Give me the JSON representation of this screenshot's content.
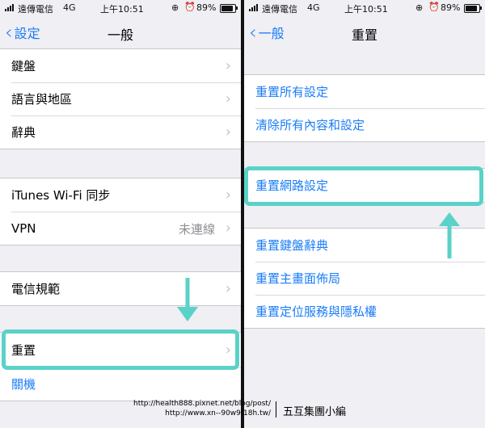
{
  "status_bar": {
    "carrier": "遠傳電信",
    "network": "4G",
    "time": "上午10:51",
    "battery_percent": "89%",
    "battery_level": 0.89
  },
  "left_screen": {
    "back_label": "設定",
    "title": "一般",
    "group1": [
      {
        "label": "鍵盤"
      },
      {
        "label": "語言與地區"
      },
      {
        "label": "辭典"
      }
    ],
    "group2": [
      {
        "label": "iTunes Wi-Fi 同步"
      },
      {
        "label": "VPN",
        "value": "未連線"
      }
    ],
    "group3": [
      {
        "label": "電信規範"
      }
    ],
    "group4": [
      {
        "label": "重置"
      },
      {
        "label": "關機"
      }
    ]
  },
  "right_screen": {
    "back_label": "一般",
    "title": "重置",
    "group1": [
      {
        "label": "重置所有設定"
      },
      {
        "label": "清除所有內容和設定"
      }
    ],
    "group2": [
      {
        "label": "重置網路設定"
      }
    ],
    "group3": [
      {
        "label": "重置鍵盤辭典"
      },
      {
        "label": "重置主畫面佈局"
      },
      {
        "label": "重置定位服務與隱私權"
      }
    ]
  },
  "watermark": {
    "url_line1": "http://health888.pixnet.net/blog/post/",
    "url_line2": "http://www.xn--90w9f18h.tw/",
    "signature": "五互集團小編"
  },
  "colors": {
    "accent": "#1a7cf6",
    "highlight": "#5ad2c8",
    "background": "#efeff4"
  }
}
